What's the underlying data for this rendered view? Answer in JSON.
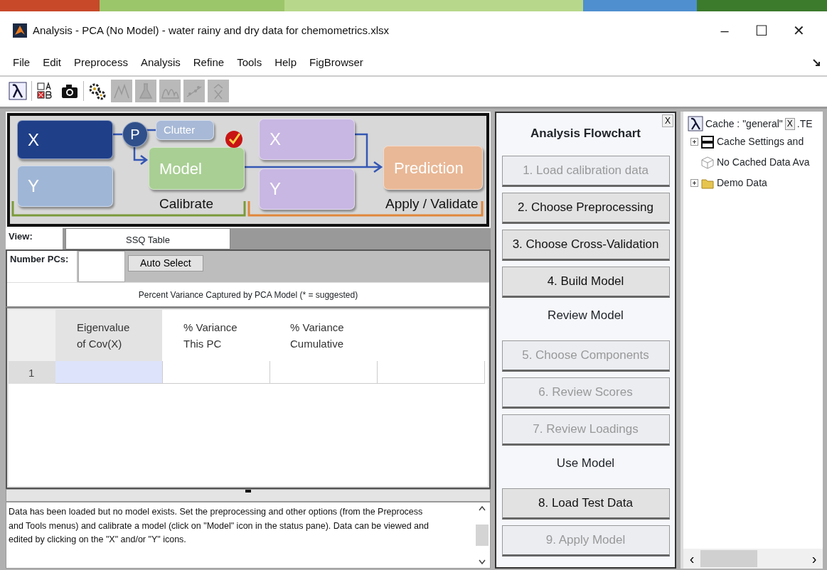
{
  "window": {
    "title": "Analysis - PCA (No Model) - water rainy and dry data for chemometrics.xlsx",
    "controls": [
      "–",
      "☐",
      "✕"
    ]
  },
  "menu": [
    "File",
    "Edit",
    "Preprocess",
    "Analysis",
    "Refine",
    "Tools",
    "Help",
    "FigBrowser"
  ],
  "toolbar": [
    {
      "kind": "lambda",
      "disabled": false
    },
    {
      "kind": "ab",
      "disabled": false
    },
    {
      "kind": "camera",
      "disabled": false
    },
    {
      "kind": "gears",
      "disabled": false
    },
    {
      "kind": "peaks",
      "disabled": true
    },
    {
      "kind": "flask",
      "disabled": true
    },
    {
      "kind": "spectrum",
      "disabled": true
    },
    {
      "kind": "scatter",
      "disabled": true
    },
    {
      "kind": "xhat",
      "disabled": true
    }
  ],
  "diagram": {
    "nodes": [
      {
        "label": "X",
        "kind": "data",
        "color": "#1f3f88"
      },
      {
        "label": "Y",
        "kind": "data",
        "color": "#9fb6d6"
      },
      {
        "label": "P",
        "kind": "preprocess",
        "color": "#2f4f8a"
      },
      {
        "label": "Clutter",
        "kind": "clutter",
        "color": "#a7b9d6"
      },
      {
        "label": "Model",
        "kind": "model",
        "color": "#a9cf94",
        "checked": true
      },
      {
        "label": "X",
        "kind": "data",
        "color": "#c8b6e3"
      },
      {
        "label": "Y",
        "kind": "data",
        "color": "#c8b6e3"
      },
      {
        "label": "Prediction",
        "kind": "prediction",
        "color": "#e9b896"
      }
    ],
    "groups": [
      {
        "label": "Calibrate",
        "color": "#7a9a3a"
      },
      {
        "label": "Apply / Validate",
        "color": "#e0873a"
      }
    ]
  },
  "view": {
    "label": "View:",
    "value": "SSQ Table"
  },
  "pcs": {
    "label": "Number PCs:",
    "button": "Auto Select",
    "caption": "Percent Variance Captured by PCA Model (* = suggested)"
  },
  "table": {
    "columns": [
      {
        "lines": [
          "Eigenvalue",
          "of Cov(X)"
        ]
      },
      {
        "lines": [
          "% Variance",
          "This PC"
        ]
      },
      {
        "lines": [
          "% Variance",
          "Cumulative"
        ]
      }
    ],
    "rows": [
      {
        "label": "1",
        "cells": [
          {
            "selected": true
          },
          {
            "selected": false
          },
          {
            "selected": false
          },
          {
            "selected": false
          }
        ]
      }
    ]
  },
  "message": "Data has been loaded but no model exists. Set the preprocessing and other options (from the Preprocess and Tools menus) and calibrate a model (click on \"Model\" icon in the status pane). Data can be viewed and edited by clicking on the \"X\" and/or \"Y\" icons.",
  "flowchart": {
    "close": "X",
    "title": "Analysis Flowchart",
    "items": [
      {
        "kind": "button",
        "label": "1. Load calibration data",
        "disabled": true
      },
      {
        "kind": "button",
        "label": "2. Choose Preprocessing",
        "disabled": false
      },
      {
        "kind": "button",
        "label": "3. Choose Cross-Validation",
        "disabled": false
      },
      {
        "kind": "button",
        "label": "4. Build Model",
        "disabled": false
      },
      {
        "kind": "heading",
        "label": "Review Model"
      },
      {
        "kind": "button",
        "label": "5. Choose Components",
        "disabled": true
      },
      {
        "kind": "button",
        "label": "6. Review Scores",
        "disabled": true
      },
      {
        "kind": "button",
        "label": "7. Review Loadings",
        "disabled": true
      },
      {
        "kind": "heading",
        "label": "Use Model"
      },
      {
        "kind": "button",
        "label": "8. Load Test Data",
        "disabled": false
      },
      {
        "kind": "button",
        "label": "9. Apply Model",
        "disabled": true
      }
    ]
  },
  "cache": {
    "title": "Cache : \"general\"",
    "close": "X",
    "extra": ".TE",
    "items": [
      {
        "label": "Cache Settings and",
        "kind": "settings"
      },
      {
        "label": "No Cached Data Ava",
        "kind": "empty"
      },
      {
        "label": "Demo Data",
        "kind": "folder"
      }
    ],
    "scroll_left": "‹",
    "scroll_right": "›"
  }
}
